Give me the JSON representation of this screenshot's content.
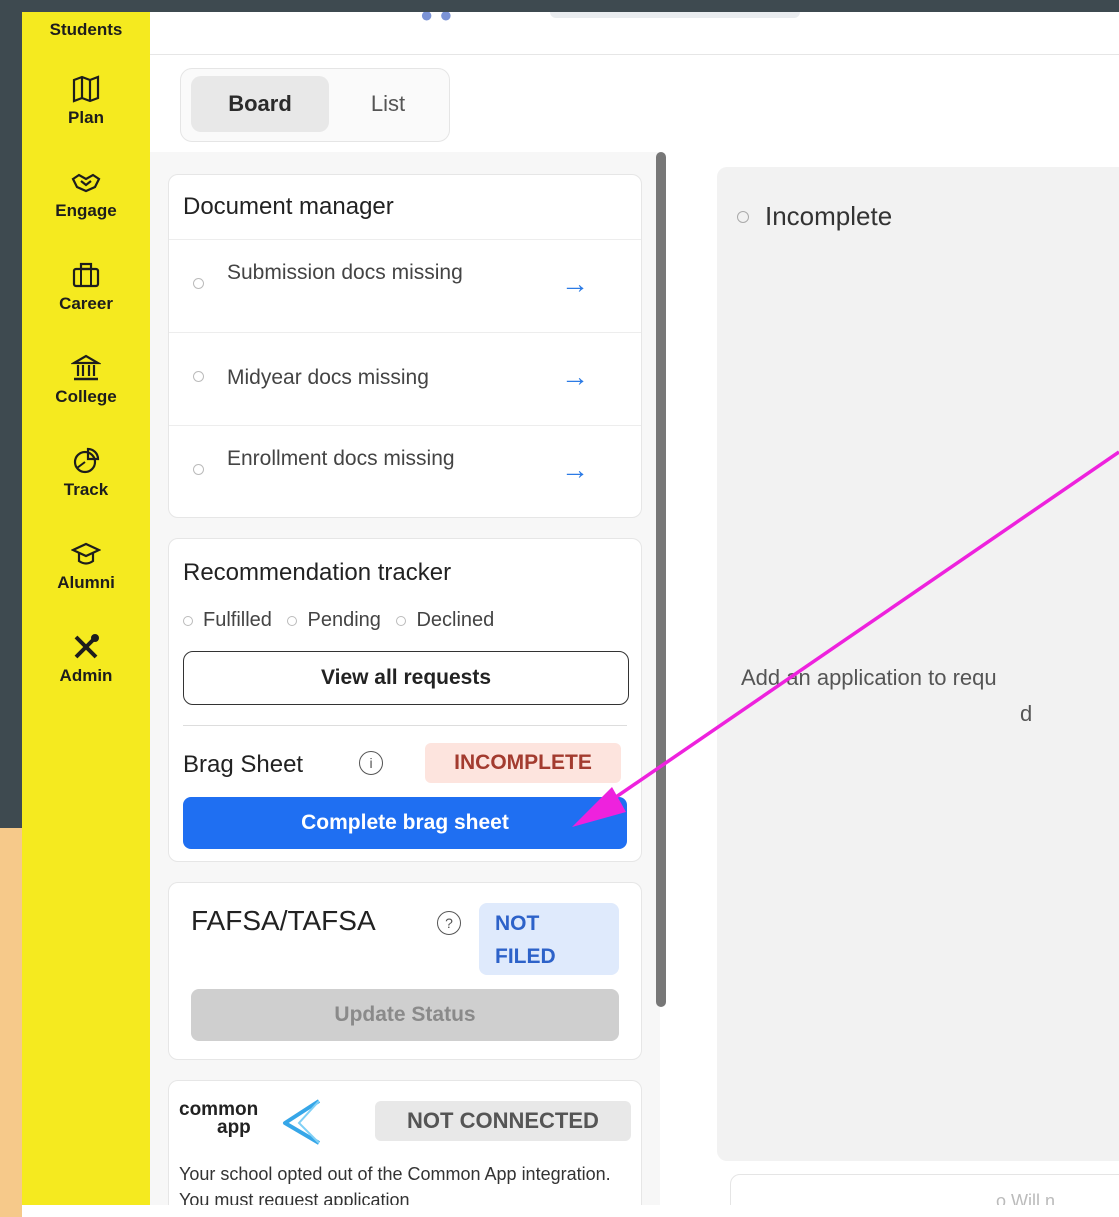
{
  "sidebar": {
    "items": [
      {
        "label": "Students",
        "icon": "students-icon"
      },
      {
        "label": "Plan",
        "icon": "map-icon"
      },
      {
        "label": "Engage",
        "icon": "handshake-icon"
      },
      {
        "label": "Career",
        "icon": "briefcase-icon"
      },
      {
        "label": "College",
        "icon": "college-icon"
      },
      {
        "label": "Track",
        "icon": "pie-chart-icon"
      },
      {
        "label": "Alumni",
        "icon": "graduation-cap-icon"
      },
      {
        "label": "Admin",
        "icon": "tools-icon"
      }
    ],
    "color": "#f5ea1f"
  },
  "view_toggle": {
    "board": "Board",
    "list": "List"
  },
  "document_manager": {
    "title": "Document manager",
    "rows": [
      {
        "label": "Submission docs missing"
      },
      {
        "label": "Midyear docs missing"
      },
      {
        "label": "Enrollment docs missing"
      }
    ]
  },
  "recommendation_tracker": {
    "title": "Recommendation tracker",
    "statuses": [
      "Fulfilled",
      "Pending",
      "Declined"
    ],
    "view_all": "View all requests"
  },
  "brag_sheet": {
    "title": "Brag Sheet",
    "badge": "INCOMPLETE",
    "button": "Complete brag sheet"
  },
  "fafsa": {
    "title": "FAFSA/TAFSA",
    "badge_line1": "NOT",
    "badge_line2": "FILED",
    "button": "Update Status"
  },
  "common_app": {
    "logo_line1": "common",
    "logo_line2": "app",
    "badge": "NOT CONNECTED",
    "description": "Your school opted out of the Common App integration. You must request application"
  },
  "board_column": {
    "title": "Incomplete",
    "empty_line1": "Add an application to requ",
    "empty_line2": "d",
    "bottom_text": "o  Will n"
  },
  "colors": {
    "primary": "#1f6ff2",
    "annotation": "#ee22dd",
    "incomplete_bg": "#fde4de",
    "not_filed_bg": "#dfeafc"
  }
}
